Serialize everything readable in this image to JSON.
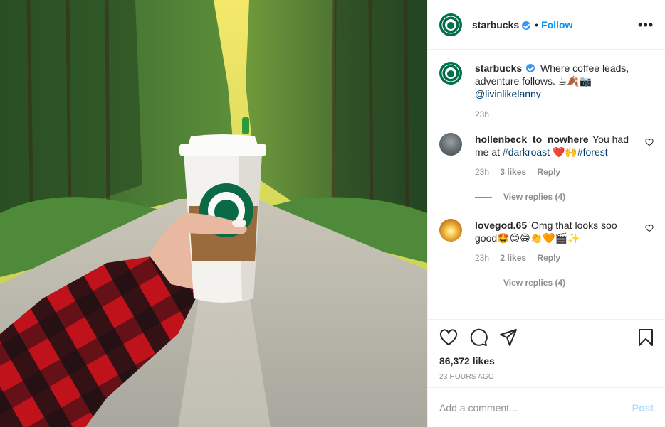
{
  "post": {
    "image_alt": "Hand holding a Starbucks cup on a forest road",
    "colors": {
      "brand": "#00704a",
      "link": "#00376b",
      "accent": "#0095f6"
    }
  },
  "header": {
    "username": "starbucks",
    "separator": "•",
    "follow_label": "Follow",
    "more_label": "•••"
  },
  "caption": {
    "username": "starbucks",
    "text": "Where coffee leads, adventure follows. ☕🍂📷",
    "mention": "@livinlikelanny",
    "time": "23h"
  },
  "comments": [
    {
      "username": "hollenbeck_to_nowhere",
      "text_before": "You had me at ",
      "hashtag1": "#darkroast",
      "emoji": " ❤️🙌",
      "hashtag2": "#forest",
      "time": "23h",
      "likes": "3 likes",
      "reply": "Reply",
      "view_replies": "View replies (4)"
    },
    {
      "username": "lovegod.65",
      "text": "Omg that looks soo good🤩😊😁👏🧡🎬✨",
      "time": "23h",
      "likes": "2 likes",
      "reply": "Reply",
      "view_replies": "View replies (4)"
    }
  ],
  "actions": {
    "likes": "86,372 likes",
    "ago": "23 HOURS AGO"
  },
  "add_comment": {
    "placeholder": "Add a comment...",
    "post_label": "Post"
  }
}
